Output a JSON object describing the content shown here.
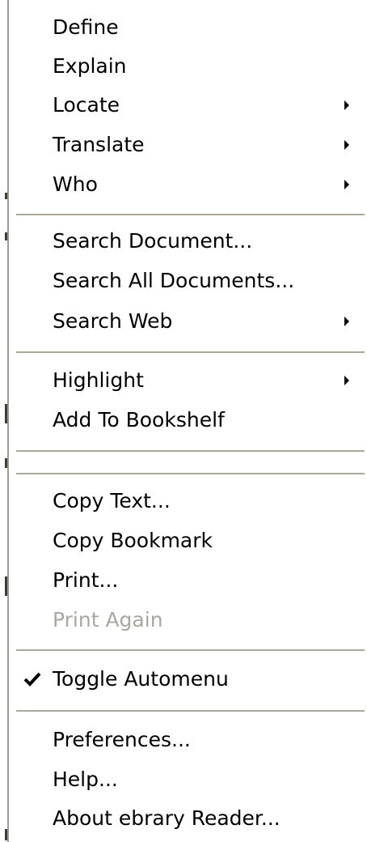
{
  "menu": {
    "items": [
      {
        "label": "Define",
        "enabled": true,
        "submenu": false,
        "checked": false
      },
      {
        "label": "Explain",
        "enabled": true,
        "submenu": false,
        "checked": false
      },
      {
        "label": "Locate",
        "enabled": true,
        "submenu": true,
        "checked": false
      },
      {
        "label": "Translate",
        "enabled": true,
        "submenu": true,
        "checked": false
      },
      {
        "label": "Who",
        "enabled": true,
        "submenu": true,
        "checked": false
      },
      {
        "label": "Search Document...",
        "enabled": true,
        "submenu": false,
        "checked": false
      },
      {
        "label": "Search All Documents...",
        "enabled": true,
        "submenu": false,
        "checked": false
      },
      {
        "label": "Search Web",
        "enabled": true,
        "submenu": true,
        "checked": false
      },
      {
        "label": "Highlight",
        "enabled": true,
        "submenu": true,
        "checked": false
      },
      {
        "label": "Add To Bookshelf",
        "enabled": true,
        "submenu": false,
        "checked": false
      },
      {
        "label": "Copy Text...",
        "enabled": true,
        "submenu": false,
        "checked": false
      },
      {
        "label": "Copy Bookmark",
        "enabled": true,
        "submenu": false,
        "checked": false
      },
      {
        "label": "Print...",
        "enabled": true,
        "submenu": false,
        "checked": false
      },
      {
        "label": "Print Again",
        "enabled": false,
        "submenu": false,
        "checked": false
      },
      {
        "label": "Toggle Automenu",
        "enabled": true,
        "submenu": false,
        "checked": true
      },
      {
        "label": "Preferences...",
        "enabled": true,
        "submenu": false,
        "checked": false
      },
      {
        "label": "Help...",
        "enabled": true,
        "submenu": false,
        "checked": false
      },
      {
        "label": "About ebrary Reader...",
        "enabled": true,
        "submenu": false,
        "checked": false
      }
    ],
    "icons": {
      "submenu": "triangle-right-icon",
      "check": "checkmark-icon"
    },
    "colors": {
      "background": "#ffffff",
      "text": "#000000",
      "disabled_text": "#a8a8a0",
      "separator": "#aca899"
    }
  }
}
